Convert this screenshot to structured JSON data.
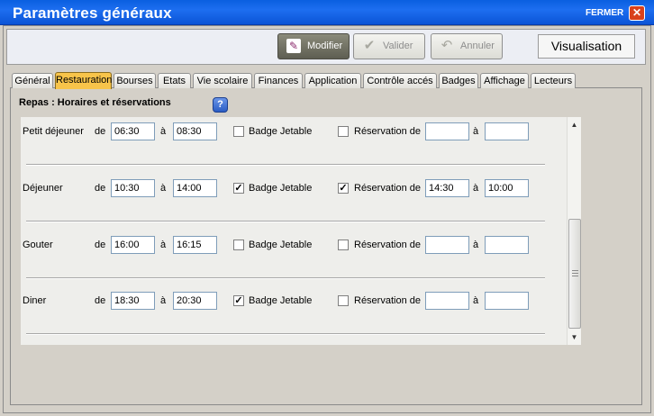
{
  "window": {
    "title": "Paramètres généraux",
    "close_label": "FERMER",
    "close_glyph": "✕"
  },
  "toolbar": {
    "modifier_label": "Modifier",
    "valider_label": "Valider",
    "annuler_label": "Annuler",
    "mode_label": "Visualisation"
  },
  "tabs": [
    "Général",
    "Restauration",
    "Bourses",
    "Etats",
    "Vie scolaire",
    "Finances",
    "Application",
    "Contrôle accés",
    "Badges",
    "Affichage",
    "Lecteurs"
  ],
  "active_tab": "Restauration",
  "section": {
    "title": "Repas : Horaires et réservations",
    "help_glyph": "?"
  },
  "labels": {
    "de": "de",
    "a": "à",
    "badge": "Badge Jetable",
    "reservation": "Réservation de",
    "check_glyph": "✓"
  },
  "meals": [
    {
      "name": "Petit déjeuner",
      "from": "06:30",
      "to": "08:30",
      "badge": false,
      "reservation": false,
      "res_from": "",
      "res_to": ""
    },
    {
      "name": "Déjeuner",
      "from": "10:30",
      "to": "14:00",
      "badge": true,
      "reservation": true,
      "res_from": "14:30",
      "res_to": "10:00"
    },
    {
      "name": "Gouter",
      "from": "16:00",
      "to": "16:15",
      "badge": false,
      "reservation": false,
      "res_from": "",
      "res_to": ""
    },
    {
      "name": "Diner",
      "from": "18:30",
      "to": "20:30",
      "badge": true,
      "reservation": false,
      "res_from": "",
      "res_to": ""
    }
  ],
  "scrollbar": {
    "up_glyph": "▲",
    "down_glyph": "▼"
  }
}
